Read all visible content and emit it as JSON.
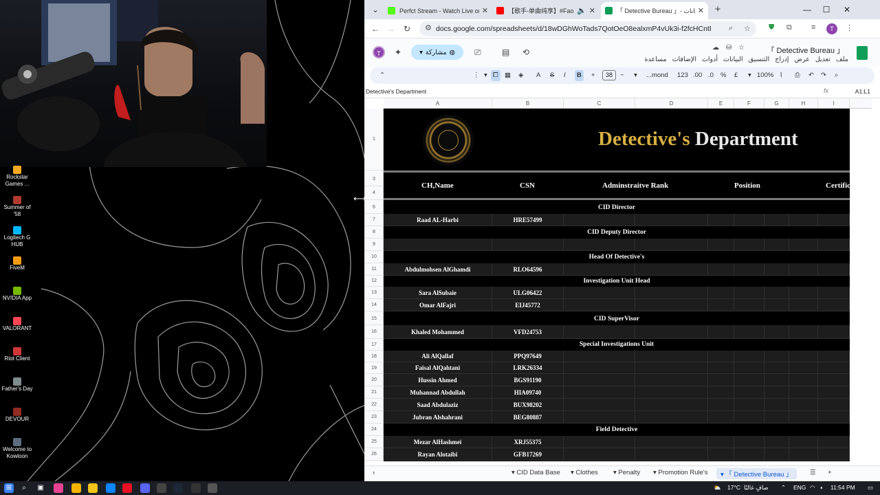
{
  "browser": {
    "tabs": [
      {
        "title": "Perfct Stream - Watch Live on K",
        "color": "#53fc18"
      },
      {
        "title": "【歌手-单曲纯享】#Faouzia #",
        "color": "#ff0000"
      },
      {
        "title": "「 Detective Bureau 」- جدول بيانات",
        "color": "#0f9d58"
      }
    ],
    "url": "docs.google.com/spreadsheets/d/18wDGhWoTads7QotOeO8ealxmP4vUk3i-f2fcHCntFmg/edit?gid=...",
    "profile_initial": "T"
  },
  "sheets": {
    "doc_title": "「 Detective Bureau 」",
    "menus": [
      "ملف",
      "تعديل",
      "عرض",
      "إدراج",
      "التنسيق",
      "البيانات",
      "أدوات",
      "الإضافات",
      "مساعدة"
    ],
    "share_label": "مشاركة",
    "toolbar": {
      "zoom": "100%",
      "currency": "£",
      "percent": "%",
      "dec_less": ".0",
      "dec_more": ".00",
      "number_format": "123",
      "font": "...mond",
      "font_size": "38",
      "bold": "B",
      "italic": "I",
      "strike": "S",
      "text_color": "A"
    },
    "formula_bar": {
      "name_box": "A1:L1",
      "content": "Detective's Department"
    },
    "columns": [
      "A",
      "B",
      "C",
      "D",
      "E",
      "F",
      "G",
      "H",
      "I"
    ],
    "rows": [
      "1",
      "3",
      "4",
      "6",
      "7",
      "8",
      "9",
      "10",
      "11",
      "12",
      "13",
      "14",
      "15",
      "16",
      "17",
      "18",
      "19",
      "20",
      "21",
      "22",
      "23",
      "24",
      "25",
      "26"
    ],
    "banner": {
      "title_part1": "Detective's",
      "title_part2": "Department"
    },
    "table_headers": [
      "CH,Name",
      "CSN",
      "Adminstraitve Rank",
      "Position",
      "Certific"
    ],
    "sections": [
      "CID Director",
      "CID Deputy Director",
      "Head Of Detective's",
      "Investigation Unit Head",
      "CID SuperVisor",
      "Special Investigations Unit",
      "Field Detective"
    ],
    "members": [
      {
        "name": "Raad AL-Harbi",
        "csn": "HRE57499"
      },
      {
        "name": "",
        "csn": ""
      },
      {
        "name": "Abdulmohsen AlGhamdi",
        "csn": "RLO64596"
      },
      {
        "name": "Sara AlSubaie",
        "csn": "ULG06422"
      },
      {
        "name": "Omar AlFajri",
        "csn": "EIJ45772"
      },
      {
        "name": "Khaled Mohammed",
        "csn": "VFD24753"
      },
      {
        "name": "Ali AlQallaf",
        "csn": "PPQ97649"
      },
      {
        "name": "Faisal AlQahtani",
        "csn": "LRK26334"
      },
      {
        "name": "Hussin Ahmed",
        "csn": "BGS91190"
      },
      {
        "name": "Muhannad Abdullah",
        "csn": "HIA09740"
      },
      {
        "name": "Saad Abdulaziz",
        "csn": "BUX98202"
      },
      {
        "name": "Jubran Alshahrani",
        "csn": "BEG80887"
      },
      {
        "name": "Mezar AlHashmei",
        "csn": "XRJ55375"
      },
      {
        "name": "Rayan Alotaibi",
        "csn": "GFB17269"
      }
    ],
    "sheet_tabs": [
      "CID Data Base",
      "Clothes",
      "Penalty",
      "Promotion Rule's",
      "「 Detective Bureau 」"
    ]
  },
  "desktop": {
    "icons": [
      {
        "label": "Rockstar\nGames ...",
        "color": "#f7a823"
      },
      {
        "label": "Summer of\n'58",
        "color": "#b03a2e"
      },
      {
        "label": "Logitech G\nHUB",
        "color": "#00b8fc"
      },
      {
        "label": "FiveM",
        "color": "#f39c12"
      },
      {
        "label": "NVIDIA App",
        "color": "#76b900"
      },
      {
        "label": "VALORANT",
        "color": "#ff4655"
      },
      {
        "label": "Riot Client",
        "color": "#d13639"
      },
      {
        "label": "Father's Day",
        "color": "#7f8c8d"
      },
      {
        "label": "DEVOUR",
        "color": "#922b21"
      },
      {
        "label": "Welcome to\nKowloon",
        "color": "#5d6d7e"
      }
    ]
  },
  "taskbar": {
    "weather": "17°C",
    "weather_desc": "صافٍ غالبًا",
    "language": "ENG",
    "time": "11:54 PM"
  },
  "colors": {
    "gold": "#d6b042",
    "cell_bg": "#1d1d1d",
    "sheets_green": "#0f9d58"
  }
}
